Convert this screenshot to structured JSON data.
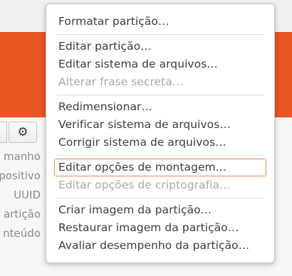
{
  "background": {
    "gear_glyph": "⚙",
    "labels": [
      "manho",
      "positivo",
      "UUID",
      "artição",
      "nteúdo"
    ]
  },
  "menu": {
    "groups": [
      [
        "Formatar partição…"
      ],
      [
        "Editar partição…",
        "Editar sistema de arquivos…",
        "Alterar frase secreta…"
      ],
      [
        "Redimensionar…",
        "Verificar sistema de arquivos…",
        "Corrigir sistema de arquivos…"
      ],
      [
        "Editar opções de montagem…",
        "Editar opções de criptografia…"
      ],
      [
        "Criar imagem da partição…",
        "Restaurar imagem da partição…",
        "Avaliar desempenho da partição…"
      ]
    ],
    "disabled": [
      "Alterar frase secreta…",
      "Editar opções de criptografia…"
    ],
    "focused": "Editar opções de montagem…",
    "colors": {
      "accent_focus": "#e9865a",
      "banner": "#e95420",
      "text": "#3c3c3c",
      "disabled_text": "#a8a8a8"
    }
  }
}
